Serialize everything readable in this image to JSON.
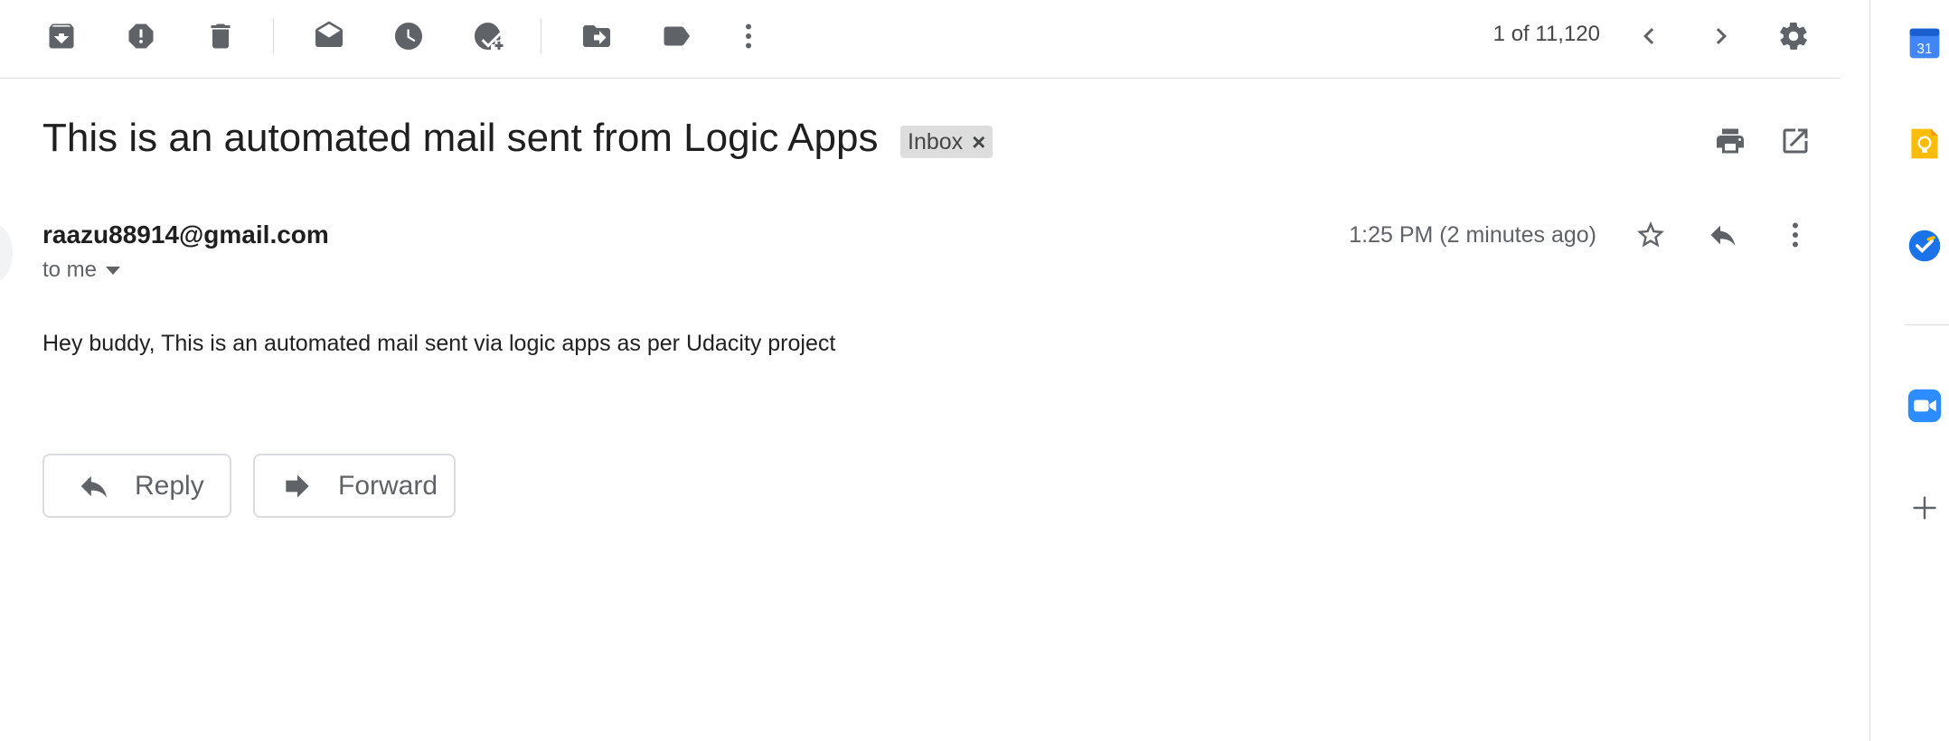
{
  "toolbar": {
    "icons": [
      "archive-icon",
      "report-spam-icon",
      "delete-icon",
      "mark-unread-icon",
      "snooze-icon",
      "add-to-tasks-icon",
      "move-to-icon",
      "labels-icon",
      "more-vert-icon"
    ],
    "page_count": "1 of 11,120"
  },
  "email": {
    "subject": "This is an automated mail sent from Logic Apps",
    "label_chip": "Inbox",
    "label_remove": "×",
    "sender": "raazu88914@gmail.com",
    "recipient": "to me",
    "timestamp": "1:25 PM (2 minutes ago)",
    "body": "Hey buddy, This is an automated mail sent via logic apps as per Udacity project"
  },
  "actions": {
    "reply_label": "Reply",
    "forward_label": "Forward"
  },
  "side_panel": {
    "calendar_day": "31",
    "apps": [
      "calendar-icon",
      "keep-icon",
      "tasks-icon",
      "zoom-icon",
      "add-icon"
    ]
  },
  "colors": {
    "icon_gray": "#5f6368",
    "chip_bg": "#dddddd",
    "calendar_blue": "#4285f4",
    "keep_yellow": "#fbbc04",
    "tasks_blue": "#1a73e8",
    "zoom_blue": "#2d8cff"
  }
}
